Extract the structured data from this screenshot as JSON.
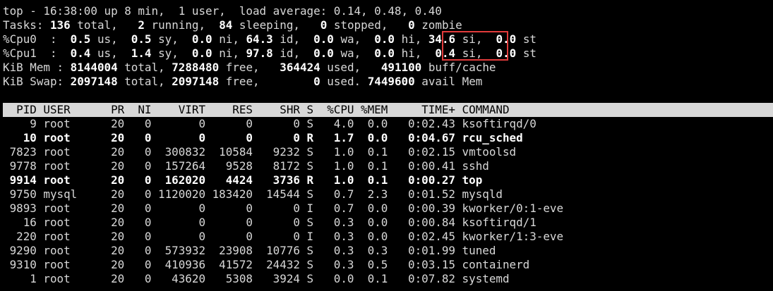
{
  "summary": {
    "top_line": "top - 16:38:00 up 8 min,  1 user,  load average: 0.14, 0.48, 0.40",
    "tasks": {
      "label": "Tasks: ",
      "total": "136",
      "t1": " total,   ",
      "running": "2",
      "t2": " running,  ",
      "sleeping": "84",
      "t3": " sleeping,   ",
      "stopped": "0",
      "t4": " stopped,   ",
      "zombie": "0",
      "t5": " zombie"
    },
    "cpu0": {
      "label": "%Cpu0  : ",
      "us": " 0.5",
      "us_l": " us, ",
      "sy": " 0.5",
      "sy_l": " sy, ",
      "ni": " 0.0",
      "ni_l": " ni, ",
      "id": "64.3",
      "id_l": " id, ",
      "wa": " 0.0",
      "wa_l": " wa, ",
      "hi": " 0.0",
      "hi_l": " hi, ",
      "si": "34.6",
      "si_l": " si, ",
      "st": " 0.0",
      "st_l": " st"
    },
    "cpu1": {
      "label": "%Cpu1  : ",
      "us": " 0.4",
      "us_l": " us, ",
      "sy": " 1.4",
      "sy_l": " sy, ",
      "ni": " 0.0",
      "ni_l": " ni, ",
      "id": "97.8",
      "id_l": " id, ",
      "wa": " 0.0",
      "wa_l": " wa, ",
      "hi": " 0.0",
      "hi_l": " hi, ",
      "si": " 0.4",
      "si_l": " si, ",
      "st": " 0.0",
      "st_l": " st"
    },
    "mem": {
      "label": "KiB Mem : ",
      "total": "8144004",
      "t1": " total, ",
      "free": "7288480",
      "t2": " free,  ",
      "used": " 364424",
      "t3": " used,  ",
      "buff": " 491100",
      "t4": " buff/cache"
    },
    "swap": {
      "label": "KiB Swap: ",
      "total": "2097148",
      "t1": " total, ",
      "free": "2097148",
      "t2": " free,  ",
      "used": "      0",
      "t3": " used. ",
      "avail": "7449600",
      "t4": " avail Mem"
    }
  },
  "table": {
    "header": "  PID USER      PR  NI    VIRT    RES    SHR S  %CPU %MEM     TIME+ COMMAND",
    "rows": [
      {
        "text": "    9 root      20   0       0      0      0 S   4.0  0.0   0:02.43 ksoftirqd/0",
        "bold": false
      },
      {
        "text": "   10 root      20   0       0      0      0 R   1.7  0.0   0:04.67 rcu_sched",
        "bold": true
      },
      {
        "text": " 7823 root      20   0  300832  10584   9232 S   1.0  0.1   0:02.15 vmtoolsd",
        "bold": false
      },
      {
        "text": " 9778 root      20   0  157264   9528   8172 S   1.0  0.1   0:00.41 sshd",
        "bold": false
      },
      {
        "text": " 9914 root      20   0  162020   4424   3736 R   1.0  0.1   0:00.27 top",
        "bold": true
      },
      {
        "text": " 9750 mysql     20   0 1120020 183420  14544 S   0.7  2.3   0:01.52 mysqld",
        "bold": false
      },
      {
        "text": " 9893 root      20   0       0      0      0 I   0.7  0.0   0:00.39 kworker/0:1-eve",
        "bold": false
      },
      {
        "text": "   16 root      20   0       0      0      0 S   0.3  0.0   0:00.84 ksoftirqd/1",
        "bold": false
      },
      {
        "text": "  220 root      20   0       0      0      0 I   0.3  0.0   0:02.45 kworker/1:3-eve",
        "bold": false
      },
      {
        "text": " 9290 root      20   0  573932  23908  10776 S   0.3  0.3   0:01.99 tuned",
        "bold": false
      },
      {
        "text": " 9310 root      20   0  410936  41572  24432 S   0.3  0.5   0:03.15 containerd",
        "bold": false
      },
      {
        "text": "    1 root      20   0   43620   5308   3924 S   0.0  0.1   0:07.82 systemd",
        "bold": false
      }
    ]
  }
}
